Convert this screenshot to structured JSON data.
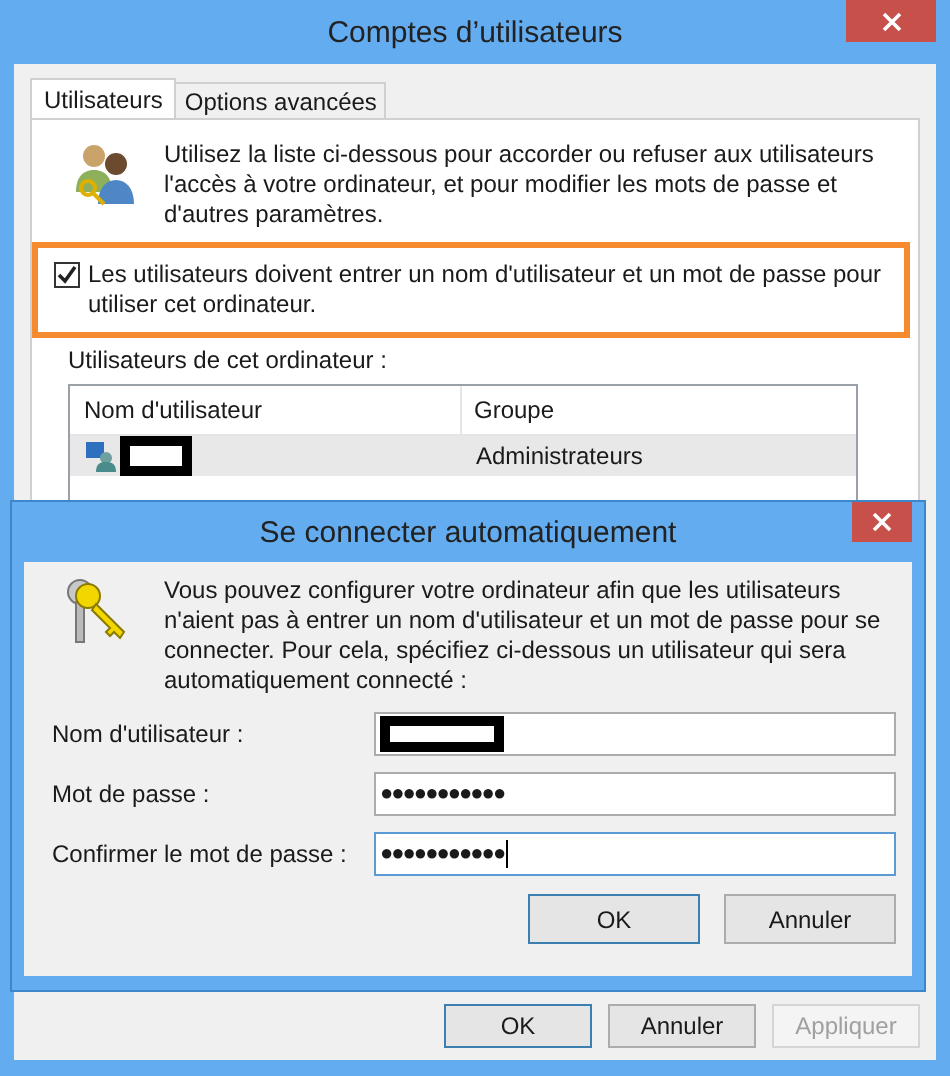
{
  "window": {
    "title": "Comptes d’utilisateurs"
  },
  "tabs": [
    {
      "label": "Utilisateurs",
      "selected": true
    },
    {
      "label": "Options avancées",
      "selected": false
    }
  ],
  "intro": "Utilisez la liste ci-dessous pour accorder ou refuser aux utilisateurs l'accès à votre ordinateur, et pour modifier les mots de passe et d'autres paramètres.",
  "require_login": {
    "label": "Les utilisateurs doivent entrer un nom d'utilisateur et un mot de passe pour utiliser cet ordinateur.",
    "checked": true,
    "highlighted": true
  },
  "users_label": "Utilisateurs de cet ordinateur :",
  "users_table": {
    "columns": [
      "Nom d'utilisateur",
      "Groupe"
    ],
    "rows": [
      {
        "group": "Administrateurs",
        "selected": true
      }
    ]
  },
  "buttons": [
    {
      "label": "OK",
      "default": true,
      "disabled": false
    },
    {
      "label": "Annuler",
      "default": false,
      "disabled": false
    },
    {
      "label": "Appliquer",
      "default": false,
      "disabled": true
    }
  ],
  "dialog": {
    "title": "Se connecter automatiquement",
    "message": "Vous pouvez configurer votre ordinateur afin que les utilisateurs n'aient pas à entrer un nom d'utilisateur et un mot de passe pour se connecter. Pour cela, spécifiez ci-dessous un utilisateur qui sera automatiquement connecté :",
    "fields": [
      {
        "label": "Nom d'utilisateur :",
        "kind": "redacted",
        "focused": false
      },
      {
        "label": "Mot de passe :",
        "kind": "password",
        "value": "●●●●●●●●●●●",
        "focused": false
      },
      {
        "label": "Confirmer le mot de passe :",
        "kind": "password",
        "value": "●●●●●●●●●●●",
        "focused": true
      }
    ],
    "buttons": [
      {
        "label": "OK",
        "default": true
      },
      {
        "label": "Annuler",
        "default": false
      }
    ]
  }
}
